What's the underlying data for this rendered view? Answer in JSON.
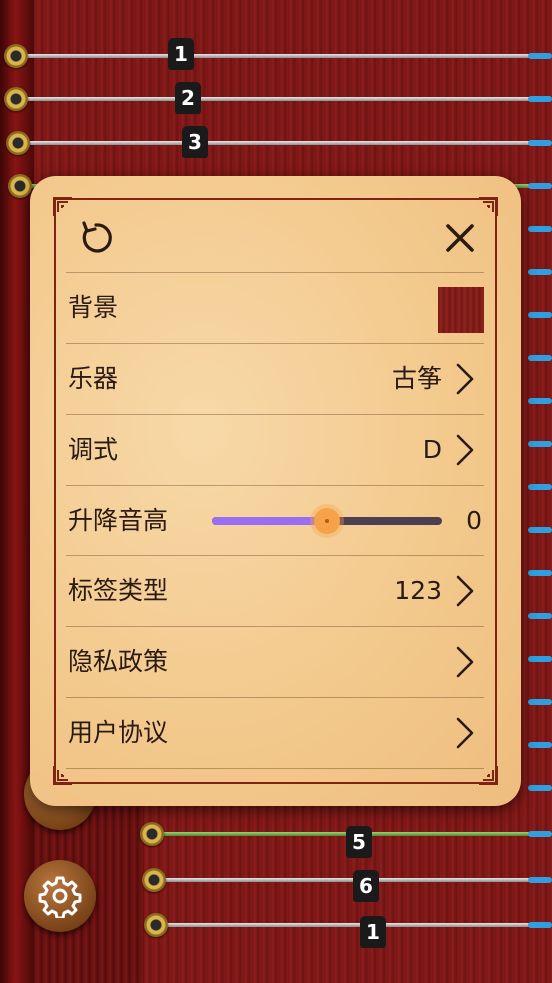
{
  "instrument_view": {
    "bridge_labels_top": [
      "1",
      "2",
      "3"
    ],
    "bridge_labels_bottom": [
      "5",
      "6",
      "1"
    ]
  },
  "settings_dialog": {
    "reset_icon": "reset-icon",
    "close_icon": "close-icon",
    "rows": {
      "background": {
        "label": "背景",
        "swatch_color": "#7e1a17"
      },
      "instrument": {
        "label": "乐器",
        "value": "古筝"
      },
      "mode": {
        "label": "调式",
        "value": "D"
      },
      "pitch": {
        "label": "升降音高",
        "value": "0",
        "slider_fraction": 0.5
      },
      "label_type": {
        "label": "标签类型",
        "value": "123"
      },
      "privacy": {
        "label": "隐私政策"
      },
      "agreement": {
        "label": "用户协议"
      }
    }
  },
  "floating_buttons": {
    "settings_icon": "gear-icon"
  },
  "colors": {
    "accent_purple": "#9a6df2",
    "thumb_orange": "#f5a24a",
    "frame_brown": "#7d2413",
    "string_tip_blue": "#2f9fe0"
  }
}
